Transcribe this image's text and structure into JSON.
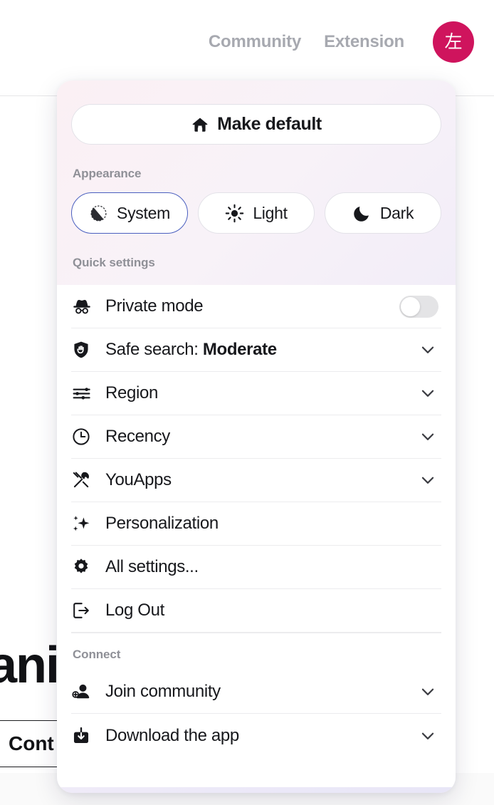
{
  "header": {
    "nav_links": [
      {
        "label": "Community",
        "name": "nav-link-community"
      },
      {
        "label": "Extension",
        "name": "nav-link-extension"
      }
    ],
    "avatar_text": "左",
    "avatar_color": "#cf145d"
  },
  "background": {
    "heading_fragment": "ani",
    "box_label": "Cont"
  },
  "dropdown": {
    "make_default": {
      "label": "Make default",
      "icon": "home-icon"
    },
    "appearance": {
      "section_label": "Appearance",
      "options": [
        {
          "label": "System",
          "icon": "contrast-circle-icon",
          "selected": true
        },
        {
          "label": "Light",
          "icon": "sun-icon",
          "selected": false
        },
        {
          "label": "Dark",
          "icon": "moon-icon",
          "selected": false
        }
      ],
      "selected_border_color": "#4a5fbf"
    },
    "quick_settings": {
      "section_label": "Quick settings",
      "items": [
        {
          "label": "Private mode",
          "icon": "incognito-hat-icon",
          "control": "toggle",
          "toggle_on": false
        },
        {
          "label": "Safe search: ",
          "value": "Moderate",
          "icon": "shield-hand-icon",
          "control": "chevron"
        },
        {
          "label": "Region",
          "icon": "sliders-icon",
          "control": "chevron"
        },
        {
          "label": "Recency",
          "icon": "clock-icon",
          "control": "chevron"
        },
        {
          "label": "YouApps",
          "icon": "tools-icon",
          "control": "chevron"
        },
        {
          "label": "Personalization",
          "icon": "sparkle-icon",
          "control": "none"
        },
        {
          "label": "All settings...",
          "icon": "gear-icon",
          "control": "none"
        },
        {
          "label": "Log Out",
          "icon": "logout-icon",
          "control": "none"
        }
      ]
    },
    "connect": {
      "section_label": "Connect",
      "items": [
        {
          "label": "Join community",
          "icon": "person-add-icon",
          "control": "chevron"
        },
        {
          "label": "Download the app",
          "icon": "download-icon",
          "control": "chevron"
        }
      ]
    }
  }
}
